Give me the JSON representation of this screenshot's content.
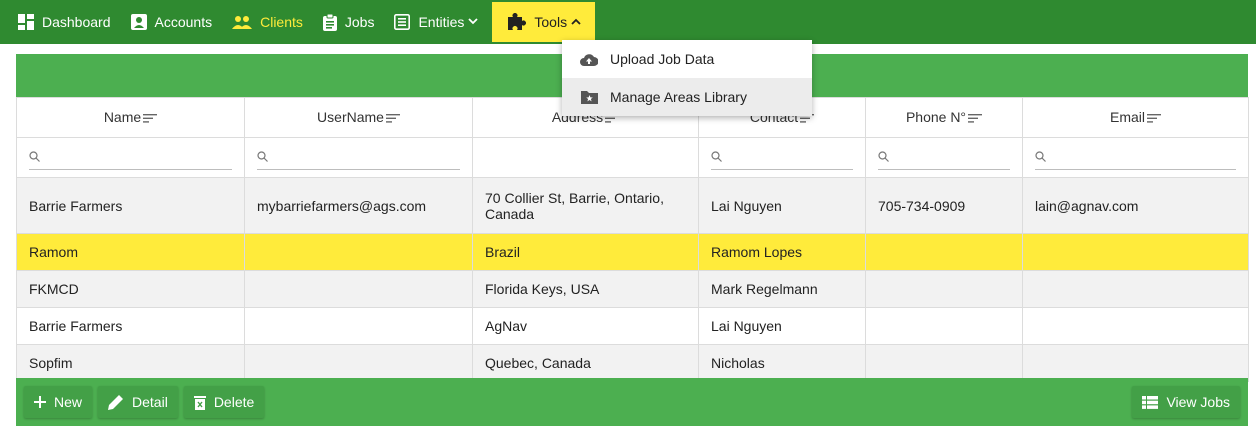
{
  "nav": {
    "dashboard": "Dashboard",
    "accounts": "Accounts",
    "clients": "Clients",
    "jobs": "Jobs",
    "entities": "Entities",
    "tools": "Tools"
  },
  "tools_menu": {
    "upload": "Upload Job Data",
    "manage": "Manage Areas Library"
  },
  "table": {
    "headers": {
      "name": "Name",
      "username": "UserName",
      "address": "Address",
      "contact": "Contact",
      "phone": "Phone N°",
      "email": "Email"
    },
    "rows": [
      {
        "name": "Barrie Farmers",
        "username": "mybarriefarmers@ags.com",
        "address": "70 Collier St, Barrie, Ontario, Canada",
        "contact": "Lai Nguyen",
        "phone": "705-734-0909",
        "email": "lain@agnav.com"
      },
      {
        "name": "Ramom",
        "username": "",
        "address": "Brazil",
        "contact": "Ramom Lopes",
        "phone": "",
        "email": ""
      },
      {
        "name": "FKMCD",
        "username": "",
        "address": "Florida Keys, USA",
        "contact": "Mark Regelmann",
        "phone": "",
        "email": ""
      },
      {
        "name": "Barrie Farmers",
        "username": "",
        "address": "AgNav",
        "contact": "Lai Nguyen",
        "phone": "",
        "email": ""
      },
      {
        "name": "Sopfim",
        "username": "",
        "address": "Quebec, Canada",
        "contact": "Nicholas",
        "phone": "",
        "email": ""
      }
    ]
  },
  "footer": {
    "new": "New",
    "detail": "Detail",
    "delete": "Delete",
    "view_jobs": "View Jobs"
  },
  "colors": {
    "topbar": "#2f8a30",
    "accent_yellow": "#ffeb3b",
    "panel_green": "#4caf50"
  }
}
